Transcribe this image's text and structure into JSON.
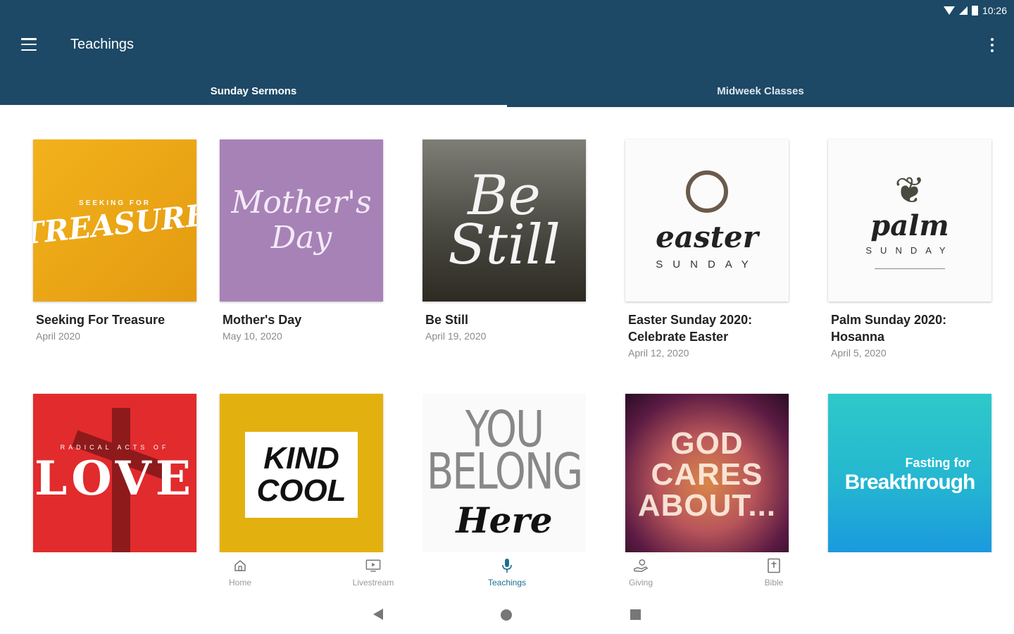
{
  "status": {
    "time": "10:26",
    "icons": [
      "wifi-icon",
      "signal-icon",
      "battery-icon"
    ]
  },
  "appbar": {
    "title": "Teachings",
    "menu_icon": "hamburger-menu-icon",
    "more_icon": "more-vert-icon"
  },
  "tabs": [
    {
      "label": "Sunday Sermons",
      "active": true
    },
    {
      "label": "Midweek Classes",
      "active": false
    }
  ],
  "cards": [
    {
      "title": "Seeking For Treasure",
      "date": "April 2020",
      "art_small": "SEEKING FOR",
      "art_big": "TREASURE"
    },
    {
      "title": "Mother's Day",
      "date": "May 10, 2020",
      "art_line1": "Mother's",
      "art_line2": "Day"
    },
    {
      "title": "Be Still",
      "date": "April 19, 2020",
      "art_line1": "Be",
      "art_line2": "Still"
    },
    {
      "title": "Easter Sunday 2020: Celebrate Easter",
      "date": "April 12, 2020",
      "art_script": "easter",
      "art_spaced": "SUNDAY"
    },
    {
      "title": "Palm Sunday 2020: Hosanna",
      "date": "April 5, 2020",
      "art_script": "palm",
      "art_spaced": "SUNDAY"
    },
    {
      "title": "",
      "date": "",
      "art_small": "RADICAL ACTS OF",
      "art_big": "LOVE"
    },
    {
      "title": "",
      "date": "",
      "art_line1": "KIND",
      "art_line2": "COOL"
    },
    {
      "title": "",
      "date": "",
      "art_line1": "YOU",
      "art_line2": "BELONG",
      "art_script": "Here"
    },
    {
      "title": "",
      "date": "",
      "art_line1": "GOD",
      "art_line2": "CARES",
      "art_line3": "ABOUT..."
    },
    {
      "title": "",
      "date": "",
      "art_small": "Fasting for",
      "art_big": "Breakthrough"
    }
  ],
  "bottom_nav": [
    {
      "label": "Home",
      "icon": "home-icon",
      "active": false
    },
    {
      "label": "Livestream",
      "icon": "tv-icon",
      "active": false
    },
    {
      "label": "Teachings",
      "icon": "microphone-icon",
      "active": true
    },
    {
      "label": "Giving",
      "icon": "hand-giving-icon",
      "active": false
    },
    {
      "label": "Bible",
      "icon": "bible-icon",
      "active": false
    }
  ],
  "system_nav": [
    "back-icon",
    "home-circle-icon",
    "recents-icon"
  ]
}
